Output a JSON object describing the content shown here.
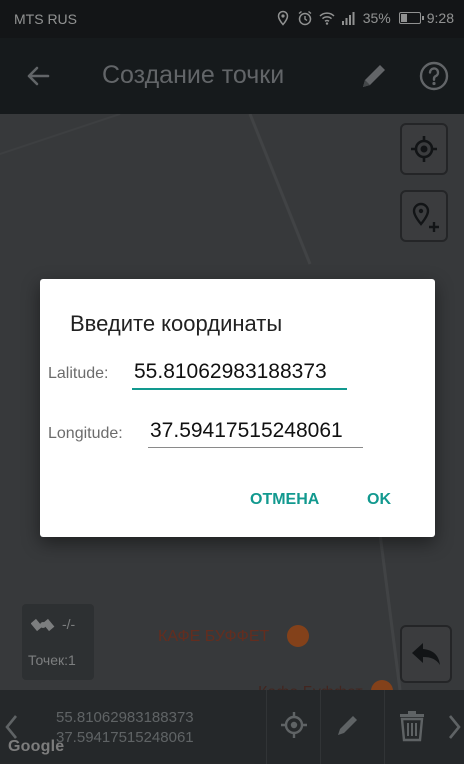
{
  "status_bar": {
    "carrier": "MTS RUS",
    "battery": "35%",
    "battery_level": 0.35,
    "time": "9:28",
    "icons": [
      "location-icon",
      "alarm-icon",
      "wifi-icon",
      "signal-icon",
      "battery-icon"
    ]
  },
  "app_bar": {
    "title": "Создание точки",
    "icons": [
      "back-arrow-icon",
      "pencil-icon",
      "help-icon"
    ]
  },
  "map": {
    "buttons": [
      "my-location-icon",
      "add-location-icon"
    ],
    "gps_status": "-/-",
    "points_count": "Точек:1",
    "poi": [
      {
        "label": "КАФЕ БУФФЕТ",
        "icon": "cafe-icon"
      },
      {
        "label": "Кафе Буффет",
        "icon": "cafe-icon"
      }
    ]
  },
  "dialog": {
    "title": "Введите координаты",
    "latitude_label": "Lalitude:",
    "latitude_value": "55.81062983188373",
    "longitude_label": "Longitude:",
    "longitude_value": "37.59417515248061",
    "cancel_label": "ОТМЕНА",
    "ok_label": "OK"
  },
  "bottom_bar": {
    "lat": "55.81062983188373",
    "lon": "37.59417515248061",
    "google_watermark": "Google",
    "icons": [
      "chevron-left-icon",
      "crosshair-icon",
      "pencil-icon",
      "trash-icon",
      "chevron-right-icon"
    ]
  },
  "colors": {
    "accent": "#12998f",
    "appbar": "#242a2e",
    "statusbar": "#1f2326",
    "poi": "#d46a2a"
  }
}
